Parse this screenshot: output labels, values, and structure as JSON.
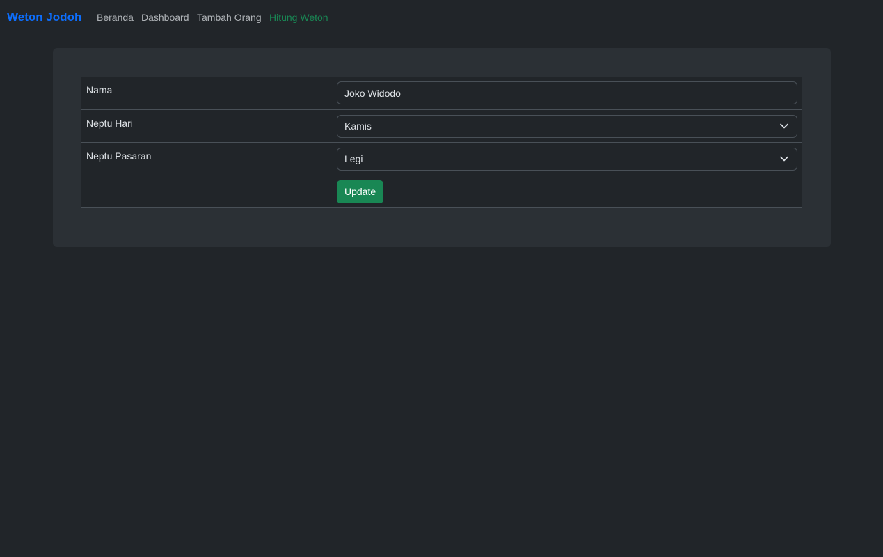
{
  "navbar": {
    "brand": "Weton Jodoh",
    "links": [
      {
        "label": "Beranda",
        "active": false
      },
      {
        "label": "Dashboard",
        "active": false
      },
      {
        "label": "Tambah Orang",
        "active": false
      },
      {
        "label": "Hitung Weton",
        "active": true
      }
    ]
  },
  "form": {
    "nama": {
      "label": "Nama",
      "value": "Joko Widodo"
    },
    "neptu_hari": {
      "label": "Neptu Hari",
      "selected": "Kamis",
      "icon": "chevron-down-icon"
    },
    "neptu_pasaran": {
      "label": "Neptu Pasaran",
      "selected": "Legi",
      "icon": "chevron-down-icon"
    },
    "submit_label": "Update"
  },
  "colors": {
    "background": "#212529",
    "card": "#2b3035",
    "brand": "#0d6efd",
    "active_link": "#198754",
    "button": "#198754"
  }
}
